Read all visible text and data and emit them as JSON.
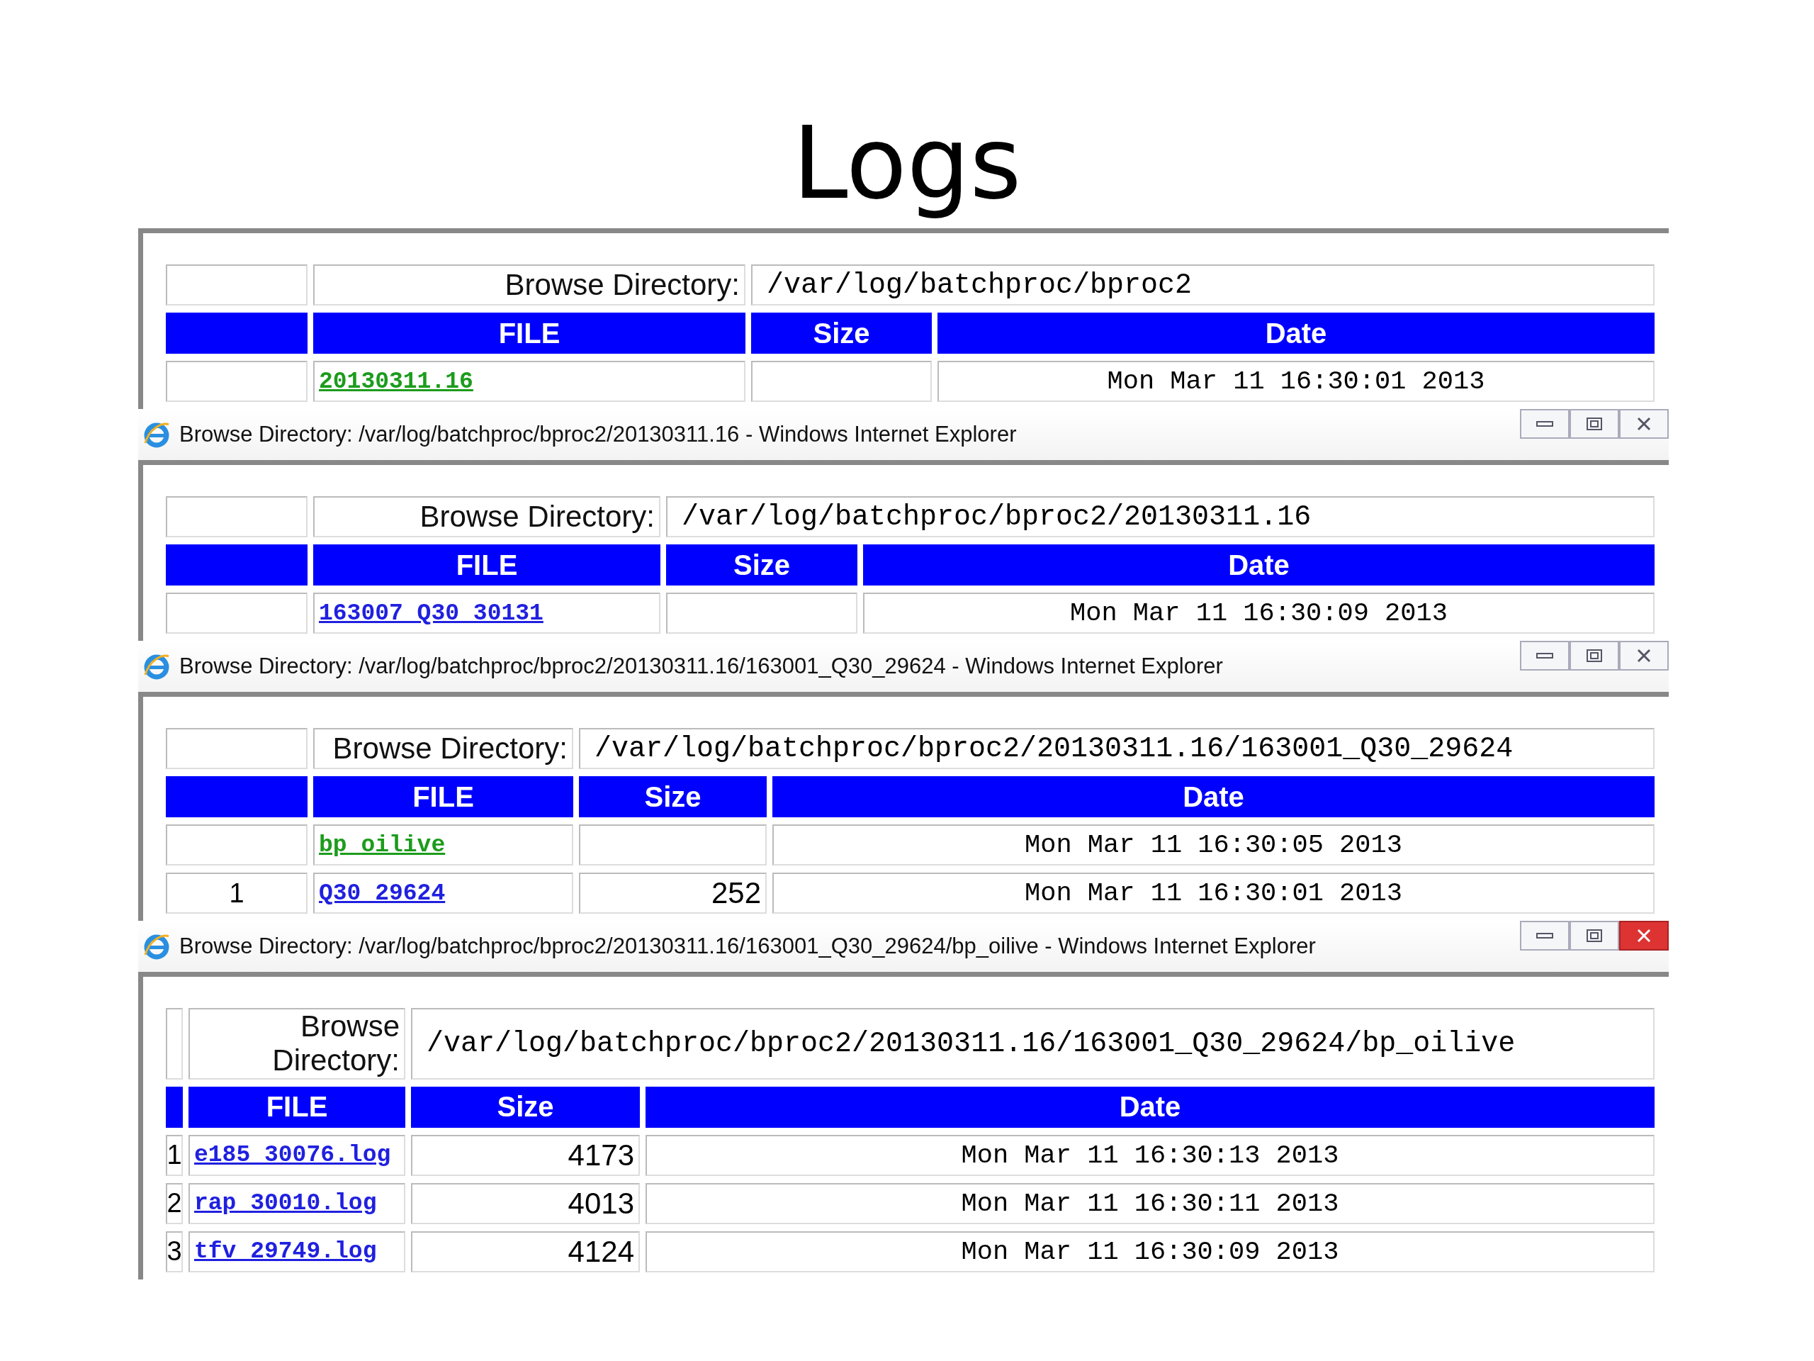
{
  "title": "Logs",
  "panels": [
    {
      "browse_label": "Browse Directory:",
      "path": "/var/log/batchproc/bproc2",
      "columns": [
        "FILE",
        "Size",
        "Date"
      ],
      "rows": [
        {
          "file": "20130311.16",
          "visited": true,
          "date": "Mon Mar 11 16:30:01 2013"
        }
      ]
    },
    {
      "title_bar": {
        "title": "Browse Directory: /var/log/batchproc/bproc2/20130311.16 - Windows Internet Explorer",
        "close_highlighted": false
      },
      "browse_label": "Browse Directory:",
      "path": "/var/log/batchproc/bproc2/20130311.16",
      "columns": [
        "FILE",
        "Size",
        "Date"
      ],
      "rows": [
        {
          "file": "163007_Q30_30131",
          "visited": false,
          "date": "Mon Mar 11 16:30:09 2013"
        }
      ]
    },
    {
      "title_bar": {
        "title": "Browse Directory: /var/log/batchproc/bproc2/20130311.16/163001_Q30_29624 - Windows Internet Explorer",
        "close_highlighted": false
      },
      "browse_label": "Browse Directory:",
      "path": "/var/log/batchproc/bproc2/20130311.16/163001_Q30_29624",
      "columns": [
        "FILE",
        "Size",
        "Date"
      ],
      "rows": [
        {
          "file": "bp_oilive",
          "visited": true,
          "date": "Mon Mar 11 16:30:05 2013"
        },
        {
          "index": "1",
          "file": "Q30_29624",
          "visited": false,
          "size": "252",
          "date": "Mon Mar 11 16:30:01 2013"
        }
      ]
    },
    {
      "title_bar": {
        "title": "Browse Directory: /var/log/batchproc/bproc2/20130311.16/163001_Q30_29624/bp_oilive - Windows Internet Explorer",
        "close_highlighted": true
      },
      "browse_label": "Browse Directory:",
      "path": "/var/log/batchproc/bproc2/20130311.16/163001_Q30_29624/bp_oilive",
      "columns": [
        "FILE",
        "Size",
        "Date"
      ],
      "rows": [
        {
          "index": "1",
          "file": "e185_30076.log",
          "visited": false,
          "size": "4173",
          "date": "Mon Mar 11 16:30:13 2013"
        },
        {
          "index": "2",
          "file": "rap_30010.log",
          "visited": false,
          "size": "4013",
          "date": "Mon Mar 11 16:30:11 2013"
        },
        {
          "index": "3",
          "file": "tfv_29749.log",
          "visited": false,
          "size": "4124",
          "date": "Mon Mar 11 16:30:09 2013"
        }
      ]
    }
  ]
}
